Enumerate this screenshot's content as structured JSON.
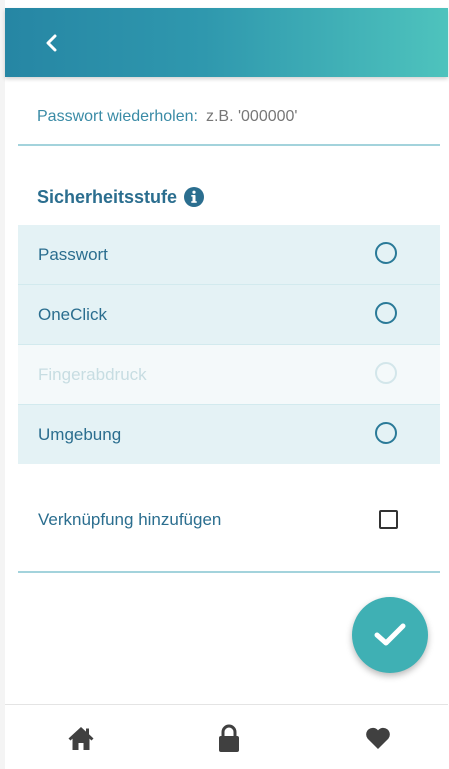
{
  "header": {
    "back_icon": "chevron-left-icon",
    "background_colors": [
      "#2686a4",
      "#4ec3bd"
    ]
  },
  "password_repeat": {
    "label": "Passwort wiederholen:",
    "placeholder": "z.B. '000000'",
    "value": ""
  },
  "security_level": {
    "title": "Sicherheitsstufe",
    "info_icon": "info-icon",
    "options": [
      {
        "label": "Passwort",
        "selected": false,
        "enabled": true
      },
      {
        "label": "OneClick",
        "selected": false,
        "enabled": true
      },
      {
        "label": "Fingerabdruck",
        "selected": false,
        "enabled": false
      },
      {
        "label": "Umgebung",
        "selected": false,
        "enabled": true
      }
    ]
  },
  "shortcut": {
    "label": "Verknüpfung hinzufügen",
    "checked": false
  },
  "confirm_button": {
    "icon": "check-icon",
    "color": "#3fb0b4"
  },
  "bottom_nav": {
    "items": [
      {
        "icon": "home-icon"
      },
      {
        "icon": "lock-icon"
      },
      {
        "icon": "heart-icon"
      }
    ]
  },
  "colors": {
    "accent": "#2b6e8f",
    "divider": "#a3d3dc",
    "option_background": "#e4f2f5",
    "fab": "#3fb0b4"
  }
}
